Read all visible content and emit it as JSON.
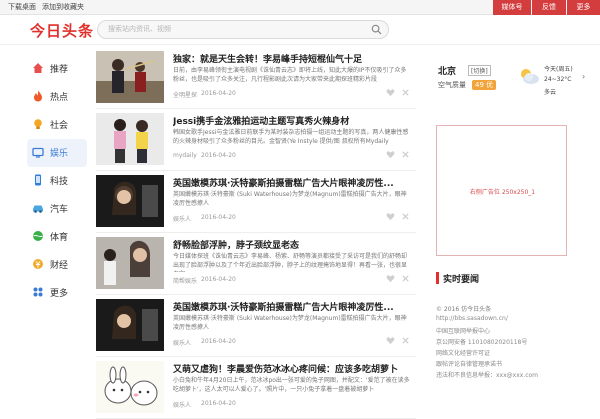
{
  "topbar": {
    "left_links": [
      "下载桌面",
      "添加到收藏夹"
    ],
    "right_buttons": [
      "媒体号",
      "反馈",
      "更多"
    ]
  },
  "header": {
    "logo": "今日头条",
    "search_placeholder": "搜索站内资讯、视频"
  },
  "sidebar": {
    "items": [
      {
        "label": "推荐",
        "icon": "recommend-icon",
        "color": "#e84f4f"
      },
      {
        "label": "热点",
        "icon": "fire-icon",
        "color": "#f05a28"
      },
      {
        "label": "社会",
        "icon": "lightbulb-icon",
        "color": "#f5a623"
      },
      {
        "label": "娱乐",
        "icon": "tv-icon",
        "color": "#3b7bd6",
        "active": true
      },
      {
        "label": "科技",
        "icon": "phone-icon",
        "color": "#2e7fd9"
      },
      {
        "label": "汽车",
        "icon": "car-icon",
        "color": "#4aa6e0"
      },
      {
        "label": "体育",
        "icon": "sports-icon",
        "color": "#3bb04a"
      },
      {
        "label": "财经",
        "icon": "money-icon",
        "color": "#f0ac32"
      },
      {
        "label": "更多",
        "icon": "more-icon",
        "color": "#3b7bd6"
      }
    ]
  },
  "feed": {
    "articles": [
      {
        "title": "独家：就是天生会转！李易峰手持短棍仙气十足",
        "summary": "日前，由李易峰领衔主演电视剧《诛仙青云志》即将上线，知此大爆的IP不仅吸引了众多粉丝，也是吸引了众多关注，凡行程影剧此次请为大家带来此期探班精彩片段",
        "source": "全明星探",
        "date": "2016-04-20"
      },
      {
        "title": "Jessi携手金泫雅拍运动主题写真秀火辣身材",
        "summary": "韩国女歌手Jessi与金泫雅日前联手为某时装杂志拍摄一组运动主题的写真，两人健康性感的火辣身材吸引了众多粉丝的目光。金智贤(Ye Instyle 提供/图 叔权所有Mydaily",
        "source": "mydaily",
        "date": "2016-04-20"
      },
      {
        "title": "英国嫩模苏琪·沃特豪斯拍摄雷糕广告大片眼神凌厉性...",
        "summary": "英国嫩模苏琪·沃特豪斯 (Suki Waterhouse)为梦龙(Magnum)雷糕拍摄广告大片，眼神凌厉性感撩人",
        "source": "娱乐人",
        "date": "2016-04-20"
      },
      {
        "title": "舒畅脸部浮肿，脖子颈纹显老态",
        "summary": "今日媒体探班《诛仙青云志》李易峰、杨紫、舒畅等演员都接受了采访可是我们的舒畅却出现了脸部浮肿以及了个年近出脸部浮肿，脖子上的纹理掩饰地显得！再看一张，也很显老啊",
        "source": "简帮娱乐",
        "date": "2016-04-20"
      },
      {
        "title": "英国嫩模苏琪·沃特豪斯拍摄雷糕广告大片眼神凌厉性...",
        "summary": "英国嫩模苏琪·沃特豪斯 (Suki Waterhouse)为梦龙(Magnum)雷糕拍摄广告大片，眼神凌厉性感撩人",
        "source": "娱乐人",
        "date": "2016-04-20"
      },
      {
        "title": "又萌又虐狗！李晨爱伤范冰冰心疼问候：应该多吃胡萝卜",
        "summary": "小白兔和牛年4月20日上午，范冰冰po出一张可爱的兔子网图，并配文：'爱范了被在读多吃胡萝卜'，这人太可以人爱心了。'照片中，一只小兔子拿着一盘着被胡萝卜",
        "source": "娱乐人",
        "date": "2016-04-20"
      }
    ]
  },
  "weather": {
    "city": "北京",
    "switch": "[切换]",
    "air_label": "空气质量",
    "air_value": "49 优",
    "day": "今天(周五)",
    "temp": "24~32°C",
    "cond": "多云"
  },
  "ad": {
    "text": "右侧广告位 250x250_1"
  },
  "hot": {
    "title": "实时要闻"
  },
  "footer": {
    "lines": [
      "© 2016 仿今日头条",
      "http://bbs.sasadown.cn/",
      "中国互联网举报中心",
      "京公网安备 11010802020118号",
      "网络文化经营许可证",
      "跟帖评论自律管理承诺书",
      "违法和不良信息举报：xxx@xxx.com"
    ]
  },
  "colors": {
    "accent": "#e0312c",
    "topbar_red": "#d43d3d",
    "active_blue": "#3b7bd6"
  }
}
